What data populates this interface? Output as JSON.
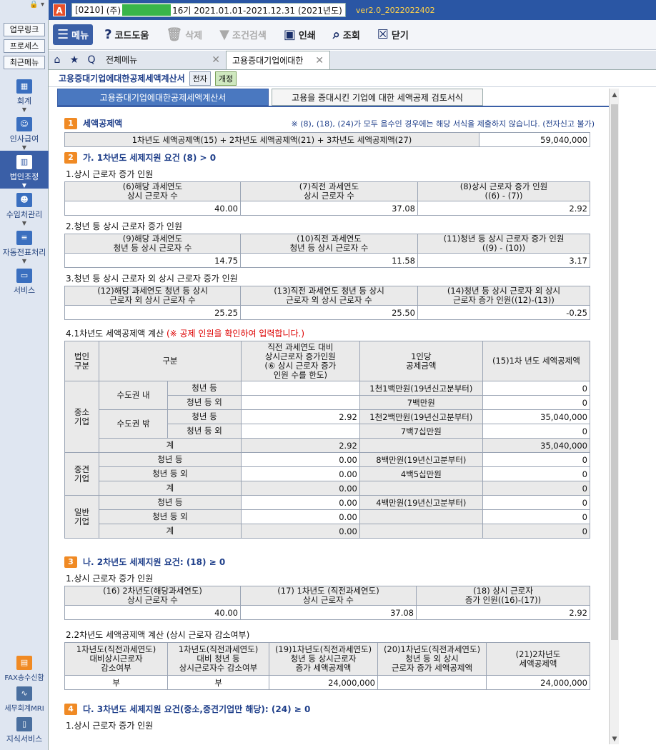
{
  "top": {
    "company_code": "[0210]",
    "company_prefix": "(주)",
    "period": "16기  2021.01.01-2021.12.31  (2021년도)",
    "version": "ver2.0_2022022402"
  },
  "side": {
    "quick": [
      "업무링크",
      "프로세스",
      "최근메뉴"
    ],
    "nav": [
      "회계",
      "인사급여",
      "법인조정",
      "수임처관리",
      "자동전표처리",
      "서비스",
      "FAX송수신함",
      "세무회계MRI",
      "지식서비스"
    ]
  },
  "toolbar": {
    "menu": "메뉴",
    "code_help": "코드도움",
    "delete": "삭제",
    "cond_search": "조건검색",
    "print": "인쇄",
    "view": "조회",
    "close": "닫기"
  },
  "tabs": {
    "all_menu": "전체메뉴",
    "current": "고용증대기업에대한"
  },
  "title": {
    "page": "고용증대기업에대한공제세액계산서",
    "chip1": "전자",
    "chip2": "개정"
  },
  "subtabs": [
    "고용증대기업에대한공제세액계산서",
    "고용을 증대시킨 기업에 대한 세액공제 검토서식"
  ],
  "s1": {
    "num": "1",
    "title": "세액공제액",
    "note": "※ (8), (18), (24)가 모두 음수인 경우에는 해당 서식을 제출하지 않습니다. (전자신고 불가)",
    "label": "1차년도 세액공제액(15) + 2차년도 세액공제액(21) + 3차년도 세액공제액(27)",
    "value": "59,040,000"
  },
  "s2": {
    "num": "2",
    "title": "가. 1차년도 세제지원 요건 (8) > 0",
    "t1": {
      "sub": "1.상시 근로자 증가 인원",
      "h1": "(6)해당 과세연도",
      "h1b": "상시 근로자 수",
      "h2": "(7)직전 과세연도",
      "h2b": "상시 근로자 수",
      "h3": "(8)상시 근로자 증가 인원",
      "h3b": "((6) - (7))",
      "v1": "40.00",
      "v2": "37.08",
      "v3": "2.92"
    },
    "t2": {
      "sub": "2.청년 등 상시 근로자 증가 인원",
      "h1": "(9)해당 과세연도",
      "h1b": "청년 등 상시 근로자 수",
      "h2": "(10)직전 과세연도",
      "h2b": "청년 등 상시 근로자 수",
      "h3": "(11)청년 등 상시 근로자 증가 인원",
      "h3b": "((9) - (10))",
      "v1": "14.75",
      "v2": "11.58",
      "v3": "3.17"
    },
    "t3": {
      "sub": "3.청년 등 상시 근로자 외 상시 근로자 증가 인원",
      "h1": "(12)해당 과세연도 청년 등 상시",
      "h1b": "근로자 외 상시 근로자 수",
      "h2": "(13)직전 과세연도 청년 등 상시",
      "h2b": "근로자 외 상시 근로자 수",
      "h3": "(14)청년 등 상시 근로자 외 상시",
      "h3b": "근로자 증가 인원((12)-(13))",
      "v1": "25.25",
      "v2": "25.50",
      "v3": "-0.25"
    },
    "t4": {
      "sub": "4.1차년도 세액공제액 계산",
      "warn": "(※ 공제 인원을 확인하여 입력합니다.)",
      "h_type": "법인\n구분",
      "h_div": "구분",
      "h_inc1": "직전 과세연도 대비",
      "h_inc2": "상시근로자 증가인원",
      "h_inc3": "(⑥ 상시 근로자 증가",
      "h_inc4": "인원 수를 한도)",
      "h_amt1": "1인당",
      "h_amt2": "공제금액",
      "h_credit": "(15)1차 년도 세액공제액",
      "sme": "중소\n기업",
      "metro_in": "수도권 내",
      "metro_out": "수도권 밖",
      "youth": "청년 등",
      "youth_ex": "청년 등 외",
      "sum": "계",
      "mid": "중견\n기업",
      "gen": "일반\n기업",
      "rows": [
        {
          "inc": "",
          "amt": "1천1백만원(19년신고분부터)",
          "credit": "0"
        },
        {
          "inc": "",
          "amt": "7백만원",
          "credit": "0"
        },
        {
          "inc": "2.92",
          "amt": "1천2백만원(19년신고분부터)",
          "credit": "35,040,000"
        },
        {
          "inc": "",
          "amt": "7백7십만원",
          "credit": "0"
        },
        {
          "inc": "2.92",
          "amt": "",
          "credit": "35,040,000"
        },
        {
          "inc": "0.00",
          "amt": "8백만원(19년신고분부터)",
          "credit": "0"
        },
        {
          "inc": "0.00",
          "amt": "4백5십만원",
          "credit": "0"
        },
        {
          "inc": "0.00",
          "amt": "",
          "credit": "0"
        },
        {
          "inc": "0.00",
          "amt": "4백만원(19년신고분부터)",
          "credit": "0"
        },
        {
          "inc": "0.00",
          "amt": "",
          "credit": "0"
        },
        {
          "inc": "0.00",
          "amt": "",
          "credit": "0"
        }
      ]
    }
  },
  "s3": {
    "num": "3",
    "title": "나. 2차년도 세제지원 요건: (18) ≥ 0",
    "t1": {
      "sub": "1.상시 근로자 증가 인원",
      "h1": "(16) 2차년도(해당과세연도)",
      "h1b": "상시 근로자 수",
      "h2": "(17) 1차년도 (직전과세연도)",
      "h2b": "상시 근로자 수",
      "h3": "(18) 상시 근로자",
      "h3b": "증가 인원((16)-(17))",
      "v1": "40.00",
      "v2": "37.08",
      "v3": "2.92"
    },
    "t2": {
      "sub": "2.2차년도 세액공제액 계산 (상시 근로자 감소여부)",
      "c1a": "1차년도(직전과세연도)",
      "c1b": "대비상시근로자",
      "c1c": "감소여부",
      "c2a": "1차년도(직전과세연도)",
      "c2b": "대비 청년 등",
      "c2c": "상시근로자수 감소여부",
      "c3a": "(19)1차년도(직전과세연도)",
      "c3b": "청년 등 상시근로자",
      "c3c": "증가 세액공제액",
      "c4a": "(20)1차년도(직전과세연도)",
      "c4b": "청년 등 외 상시",
      "c4c": "근로자 증가 세액공제액",
      "c5a": "(21)2차년도",
      "c5b": "세액공제액",
      "v1": "부",
      "v2": "부",
      "v3": "24,000,000",
      "v4": "",
      "v5": "24,000,000"
    }
  },
  "s4": {
    "num": "4",
    "title": "다. 3차년도 세제지원 요건(중소,중견기업만 해당): (24) ≥ 0",
    "sub": "1.상시 근로자 증가 인원"
  },
  "colors": {
    "brand": "#2a56a4",
    "accent": "#f08a24",
    "title": "#1f3f8a"
  }
}
